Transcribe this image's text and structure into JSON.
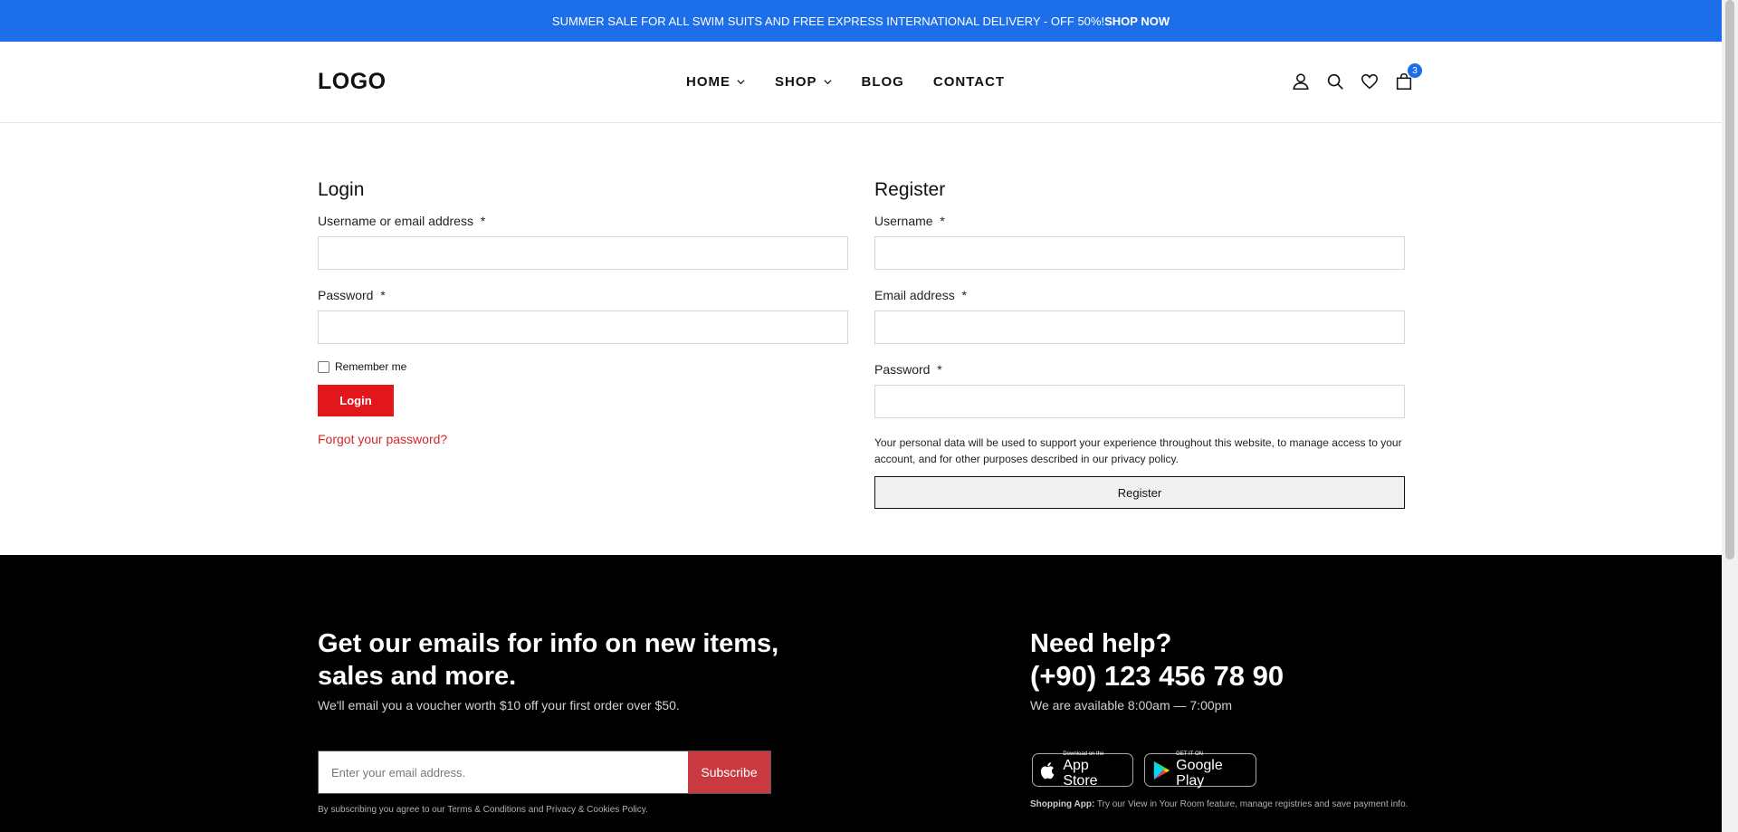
{
  "announcement": {
    "text": "SUMMER SALE FOR ALL SWIM SUITS AND FREE EXPRESS INTERNATIONAL DELIVERY - OFF 50%!",
    "link": "SHOP NOW"
  },
  "header": {
    "logo": "LOGO",
    "nav": [
      {
        "label": "HOME",
        "has_dropdown": true
      },
      {
        "label": "SHOP",
        "has_dropdown": true
      },
      {
        "label": "BLOG",
        "has_dropdown": false
      },
      {
        "label": "CONTACT",
        "has_dropdown": false
      }
    ],
    "icons": [
      "user-icon",
      "search-icon",
      "heart-icon",
      "cart-icon"
    ],
    "cart_count": "3",
    "accent_color": "#1c6fe8"
  },
  "login": {
    "title": "Login",
    "username_label": "Username or email address",
    "password_label": "Password",
    "required_mark": "*",
    "remember_label": "Remember me",
    "button": "Login",
    "forgot": "Forgot your password?",
    "button_color": "#e3161b"
  },
  "register": {
    "title": "Register",
    "username_label": "Username",
    "email_label": "Email address",
    "password_label": "Password",
    "required_mark": "*",
    "privacy_text": "Your personal data will be used to support your experience throughout this website, to manage access to your account, and for other purposes described in our",
    "privacy_link": "privacy policy.",
    "button": "Register"
  },
  "footer": {
    "newsletter_title": "Get our emails for info on new items, sales and more.",
    "newsletter_sub": "We'll email you a voucher worth $10 off your first order over $50.",
    "email_placeholder": "Enter your email address.",
    "subscribe": "Subscribe",
    "terms": "By subscribing you agree to our Terms & Conditions and Privacy & Cookies Policy.",
    "help_title": "Need help?",
    "help_phone": "(+90) 123 456 78 90",
    "help_hours": "We are available 8:00am — 7:00pm",
    "app_store_small": "Download on the",
    "app_store_big": "App Store",
    "google_small": "GET IT ON",
    "google_big": "Google Play",
    "app_note_label": "Shopping App:",
    "app_note_text": "Try our View in Your Room feature, manage registries and save payment info."
  }
}
